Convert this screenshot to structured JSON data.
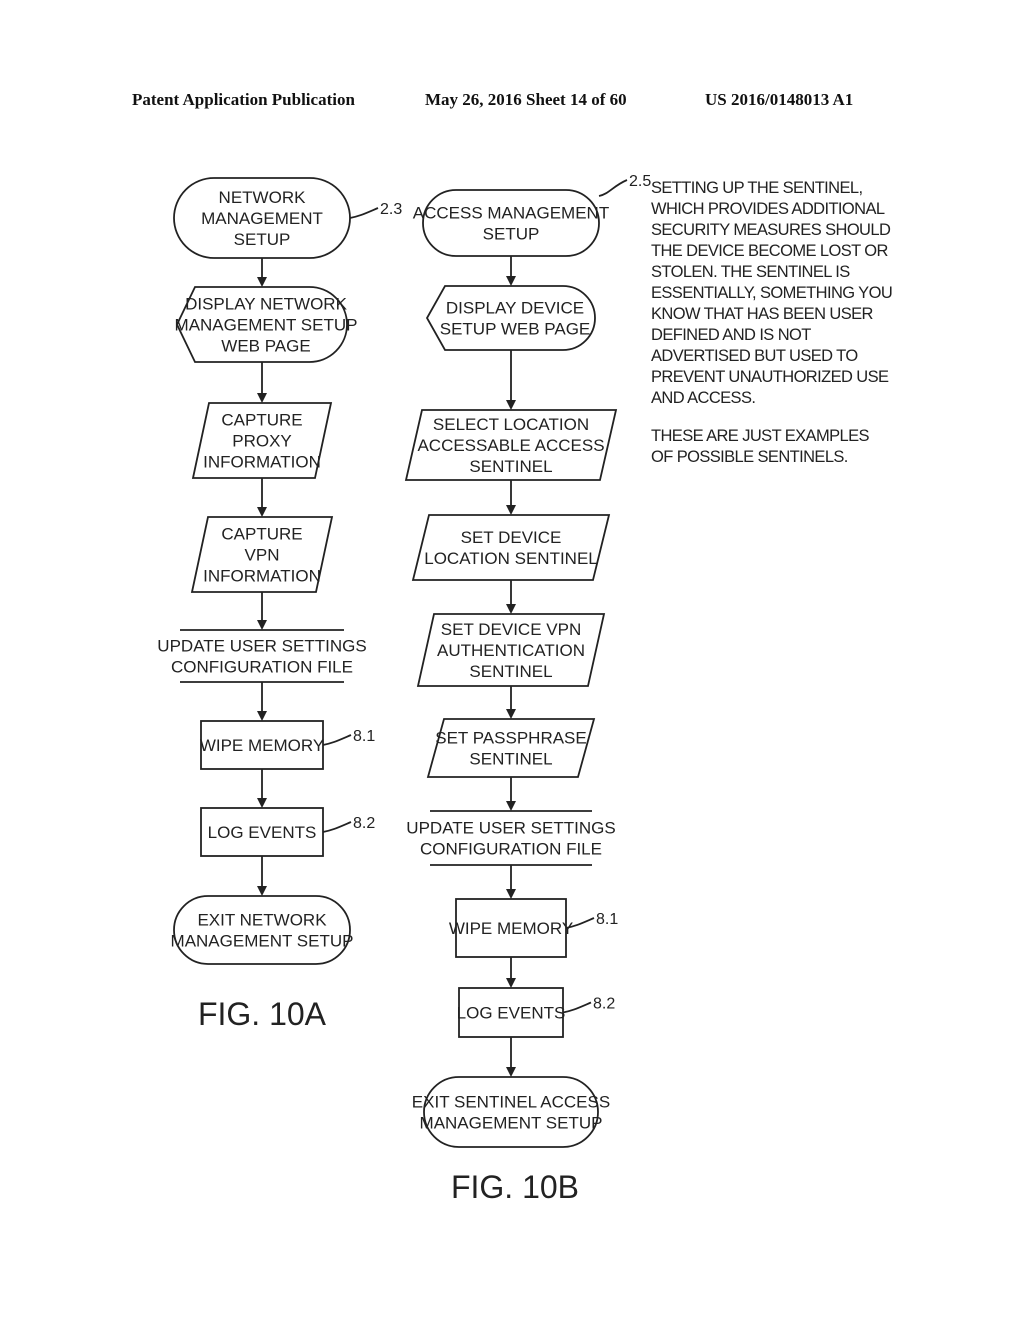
{
  "header": {
    "publication": "Patent Application Publication",
    "date_sheet": "May 26, 2016  Sheet 14 of 60",
    "number": "US 2016/0148013 A1"
  },
  "figures": [
    {
      "caption": "FIG. 10A",
      "nodes": [
        {
          "id": "a1",
          "shape": "terminal",
          "lines": [
            "NETWORK",
            "MANAGEMENT",
            "SETUP"
          ],
          "ref": "2.3"
        },
        {
          "id": "a2",
          "shape": "display",
          "lines": [
            "DISPLAY NETWORK",
            "MANAGEMENT SETUP",
            "WEB PAGE"
          ]
        },
        {
          "id": "a3",
          "shape": "io",
          "lines": [
            "CAPTURE",
            "PROXY",
            "INFORMATION"
          ]
        },
        {
          "id": "a4",
          "shape": "io",
          "lines": [
            "CAPTURE",
            "VPN",
            "INFORMATION"
          ]
        },
        {
          "id": "a5",
          "shape": "storage",
          "lines": [
            "UPDATE USER SETTINGS",
            "CONFIGURATION FILE"
          ]
        },
        {
          "id": "a6",
          "shape": "process",
          "lines": [
            "WIPE MEMORY"
          ],
          "ref": "8.1"
        },
        {
          "id": "a7",
          "shape": "process",
          "lines": [
            "LOG EVENTS"
          ],
          "ref": "8.2"
        },
        {
          "id": "a8",
          "shape": "terminal",
          "lines": [
            "EXIT NETWORK",
            "MANAGEMENT SETUP"
          ]
        }
      ]
    },
    {
      "caption": "FIG. 10B",
      "nodes": [
        {
          "id": "b1",
          "shape": "terminal",
          "lines": [
            "ACCESS MANAGEMENT",
            "SETUP"
          ],
          "ref": "2.5"
        },
        {
          "id": "b2",
          "shape": "display",
          "lines": [
            "DISPLAY DEVICE",
            "SETUP WEB PAGE"
          ]
        },
        {
          "id": "b3",
          "shape": "io",
          "lines": [
            "SELECT LOCATION",
            "ACCESSABLE ACCESS",
            "SENTINEL"
          ]
        },
        {
          "id": "b4",
          "shape": "io",
          "lines": [
            "SET DEVICE",
            "LOCATION SENTINEL"
          ]
        },
        {
          "id": "b5",
          "shape": "io",
          "lines": [
            "SET DEVICE VPN",
            "AUTHENTICATION",
            "SENTINEL"
          ]
        },
        {
          "id": "b6",
          "shape": "io",
          "lines": [
            "SET PASSPHRASE",
            "SENTINEL"
          ]
        },
        {
          "id": "b7",
          "shape": "storage",
          "lines": [
            "UPDATE USER SETTINGS",
            "CONFIGURATION FILE"
          ]
        },
        {
          "id": "b8",
          "shape": "process",
          "lines": [
            "WIPE MEMORY"
          ],
          "ref": "8.1"
        },
        {
          "id": "b9",
          "shape": "process",
          "lines": [
            "LOG EVENTS"
          ],
          "ref": "8.2"
        },
        {
          "id": "b10",
          "shape": "terminal",
          "lines": [
            "EXIT SENTINEL ACCESS",
            "MANAGEMENT SETUP"
          ]
        }
      ]
    }
  ],
  "notes": {
    "paragraph1": [
      "SETTING UP THE SENTINEL,",
      "WHICH PROVIDES ADDITIONAL",
      "SECURITY MEASURES SHOULD",
      "THE DEVICE BECOME LOST OR",
      "STOLEN. THE SENTINEL IS",
      "ESSENTIALLY, SOMETHING YOU",
      "KNOW THAT HAS BEEN USER",
      "DEFINED AND IS NOT",
      "ADVERTISED BUT USED TO",
      "PREVENT UNAUTHORIZED USE",
      "AND ACCESS."
    ],
    "paragraph2": [
      "THESE ARE JUST EXAMPLES",
      "OF POSSIBLE SENTINELS."
    ]
  }
}
